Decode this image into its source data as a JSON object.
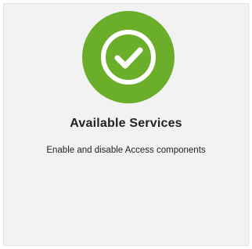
{
  "card": {
    "title": "Available Services",
    "description": "Enable and disable Access components",
    "icon": "check-circle-icon",
    "accent_color": "#6aae2a",
    "background_color": "#f2f2f2"
  }
}
